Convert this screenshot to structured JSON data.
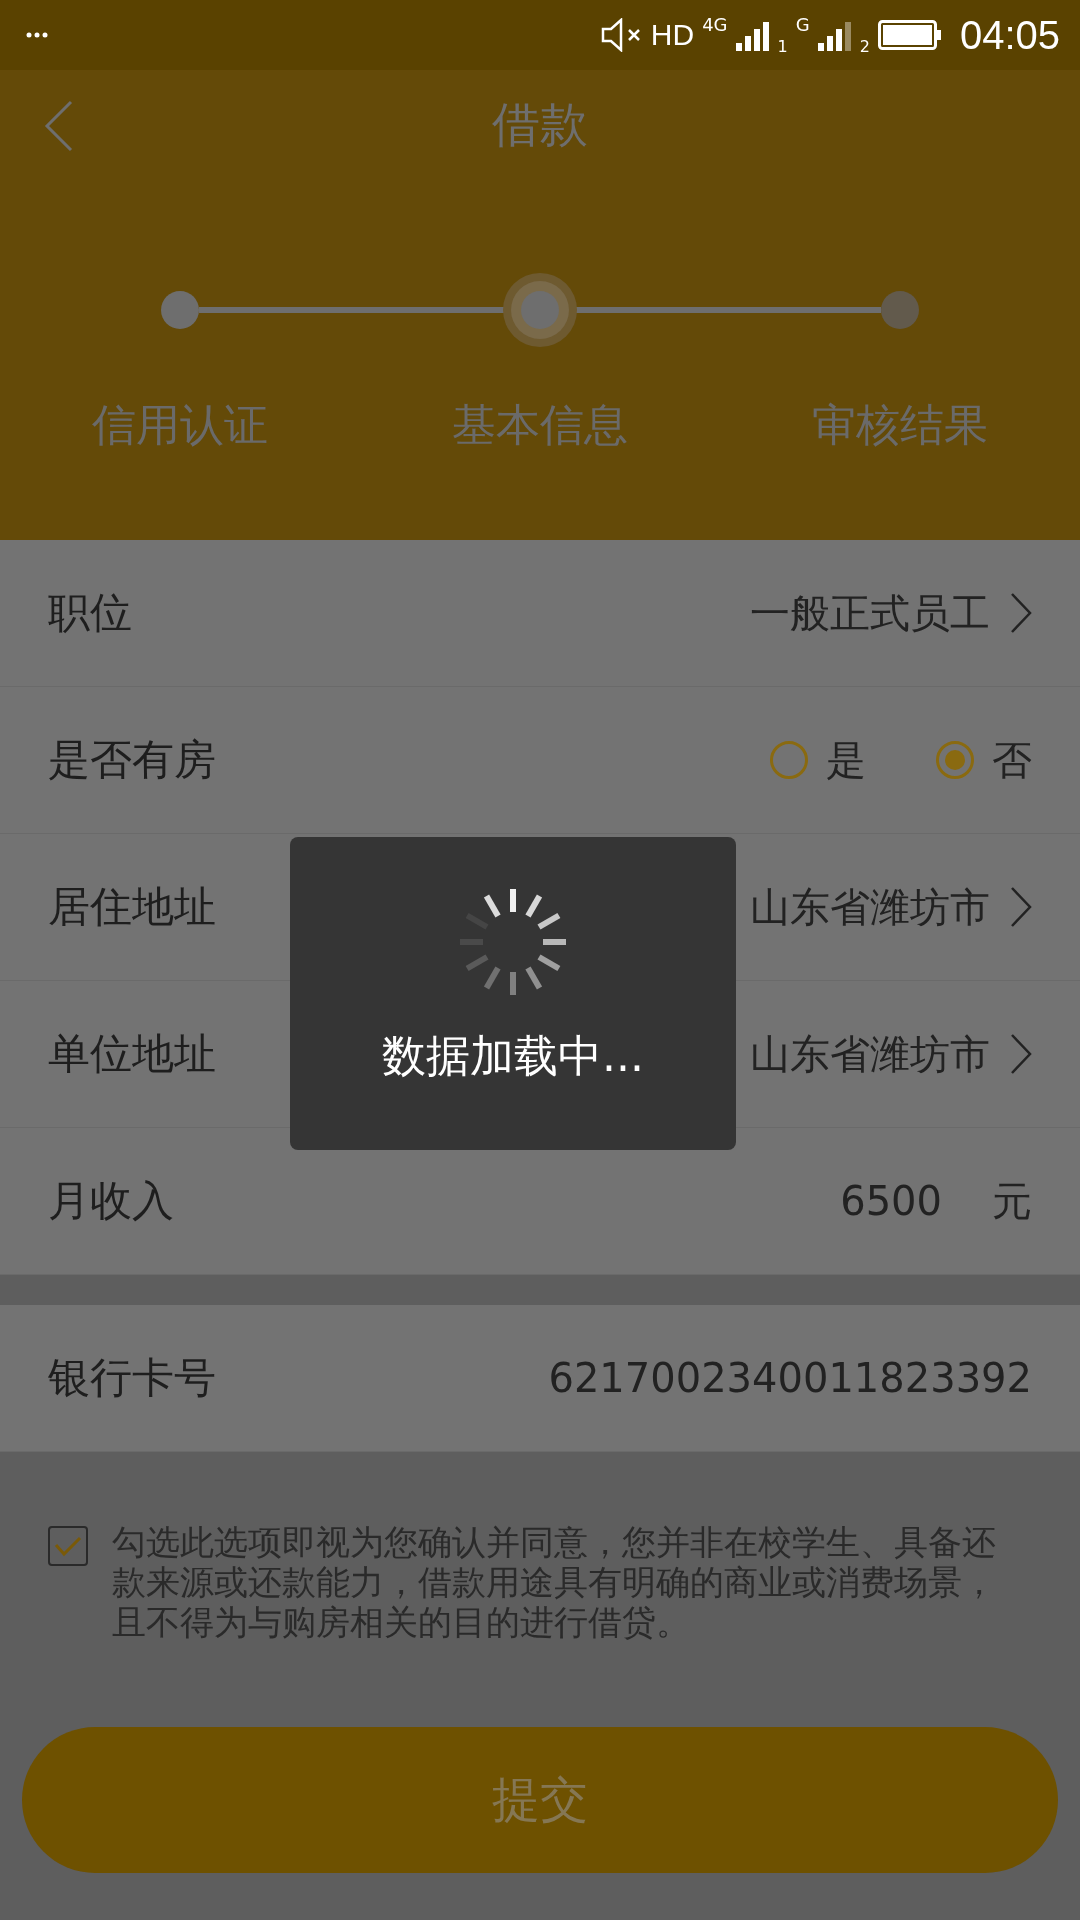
{
  "status_bar": {
    "network": "HD",
    "sim1_type": "4G",
    "sim1_slot": "1",
    "sim2_type": "G",
    "sim2_slot": "2",
    "time": "04:05"
  },
  "header": {
    "title": "借款"
  },
  "steps": [
    {
      "label": "信用认证",
      "completed": true,
      "selected": false
    },
    {
      "label": "基本信息",
      "completed": false,
      "selected": true
    },
    {
      "label": "审核结果",
      "completed": false,
      "selected": false
    }
  ],
  "form": [
    {
      "kind": "select",
      "label": "职位",
      "value": "一般正式员工"
    },
    {
      "kind": "radio",
      "label": "是否有房",
      "options": [
        {
          "label": "是",
          "selected": false
        },
        {
          "label": "否",
          "selected": true
        }
      ]
    },
    {
      "kind": "select",
      "label": "居住地址",
      "value": "山东省潍坊市"
    },
    {
      "kind": "select",
      "label": "单位地址",
      "value": "山东省潍坊市"
    },
    {
      "kind": "input",
      "label": "月收入",
      "value": "6500",
      "unit": "元"
    },
    {
      "kind": "gap"
    },
    {
      "kind": "input",
      "label": "银行卡号",
      "value": "6217002340011823392"
    }
  ],
  "agreement": {
    "checked": true,
    "text": "勾选此选项即视为您确认并同意，您并非在校学生、具备还款来源或还款能力，借款用途具有明确的商业或消费场景，且不得为与购房相关的目的进行借贷。"
  },
  "submit": {
    "label": "提交"
  },
  "loading": {
    "text": "数据加载中..."
  }
}
